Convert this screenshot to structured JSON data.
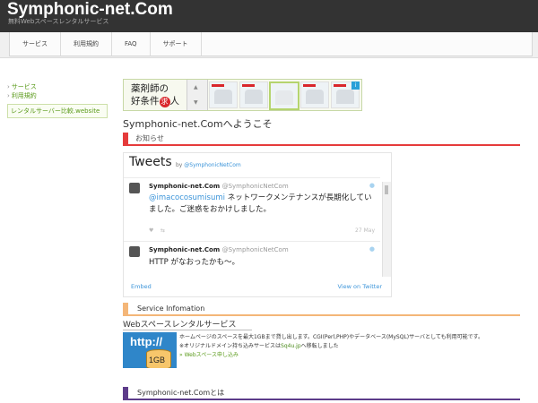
{
  "header": {
    "title": "Symphonic-net.Com",
    "tagline": "無料Webスペースレンタルサービス"
  },
  "nav": {
    "items": [
      "サービス",
      "利用規約",
      "FAQ",
      "サポート"
    ]
  },
  "sidebar": {
    "links": [
      "サービス",
      "利用規約"
    ],
    "box_link": "レンタルサーバー比較.website"
  },
  "banner": {
    "line1": "薬剤師の",
    "line2_a": "好条件",
    "line2_circle": "求",
    "line2_b": "人",
    "badge": "i"
  },
  "welcome": "Symphonic-net.Comへようこそ",
  "sections": {
    "news": "お知らせ",
    "service": "Service Infomation",
    "about": "Symphonic-net.Comとは"
  },
  "twitter": {
    "title": "Tweets",
    "by_prefix": "by",
    "by_handle": "@SymphonicNetCom",
    "tweets": [
      {
        "name": "Symphonic-net.Com",
        "handle": "@SymphonicNetCom",
        "mention": "@imacocosumisumi",
        "text": " ネットワークメンテナンスが長期化していました。ご迷惑をおかけしました。",
        "date": "27 May"
      },
      {
        "name": "Symphonic-net.Com",
        "handle": "@SymphonicNetCom",
        "text": "HTTP がなおったかも〜。"
      }
    ],
    "embed": "Embed",
    "view_on": "View on Twitter"
  },
  "service": {
    "subtitle": "Webスペースレンタルサービス",
    "image_text": "http://",
    "image_gb": "1GB",
    "line1": "ホームページのスペースを最大1GBまで貸し出します。CGI(Perl,PHP)やデータベース(MySQL)サーバとしても利用可能です。",
    "line2_a": "※オリジナルドメイン持ち込みサービスは",
    "line2_link": "Sq4u.jp",
    "line2_b": "へ移転しました",
    "apply": "» Webスペース申し込み"
  },
  "colors": {
    "news_accent": "#e53b3b",
    "service_accent": "#f4b678",
    "about_accent": "#5d3c8a",
    "link_green": "#5a9a1a",
    "twitter_blue": "#3b94d9"
  }
}
